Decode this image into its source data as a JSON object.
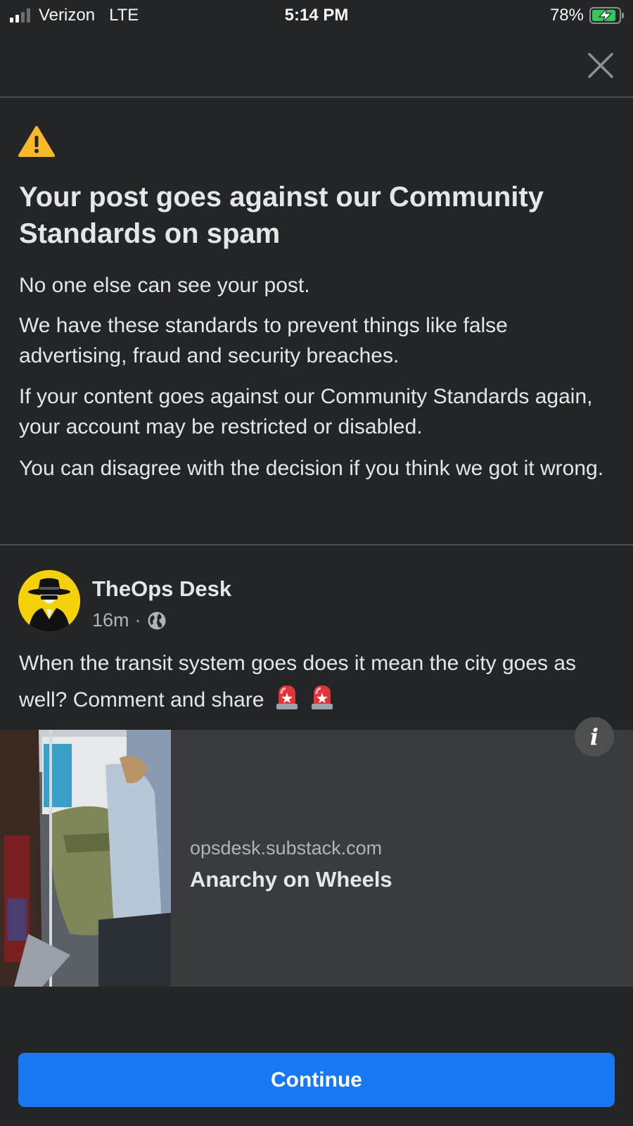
{
  "status_bar": {
    "carrier": "Verizon",
    "network": "LTE",
    "time": "5:14 PM",
    "battery_percent": "78%",
    "signal_bars_active": 2,
    "signal_bars_total": 4,
    "battery_charging": true
  },
  "top_bar": {
    "close_icon": "close-icon"
  },
  "notice": {
    "icon": "warning-icon",
    "icon_color": "#f7b928",
    "title": "Your post goes against our Community Standards on spam",
    "paragraphs": [
      "No one else can see your post.",
      "We have these standards to prevent things like false advertising, fraud and security breaches.",
      "If your content goes against our Community Standards again, your account may be restricted or disabled.",
      "You can disagree with the decision if you think we got it wrong."
    ]
  },
  "post": {
    "author": "TheOps Desk",
    "time_ago": "16m",
    "separator": "·",
    "privacy_icon": "globe-icon",
    "text": "When the transit system goes does it mean the city goes as well? Comment and share",
    "emojis": [
      "siren-icon",
      "siren-icon"
    ],
    "link": {
      "domain": "opsdesk.substack.com",
      "title": "Anarchy on Wheels",
      "info_label": "i"
    }
  },
  "footer": {
    "continue_label": "Continue",
    "accent_color": "#1877f2"
  }
}
